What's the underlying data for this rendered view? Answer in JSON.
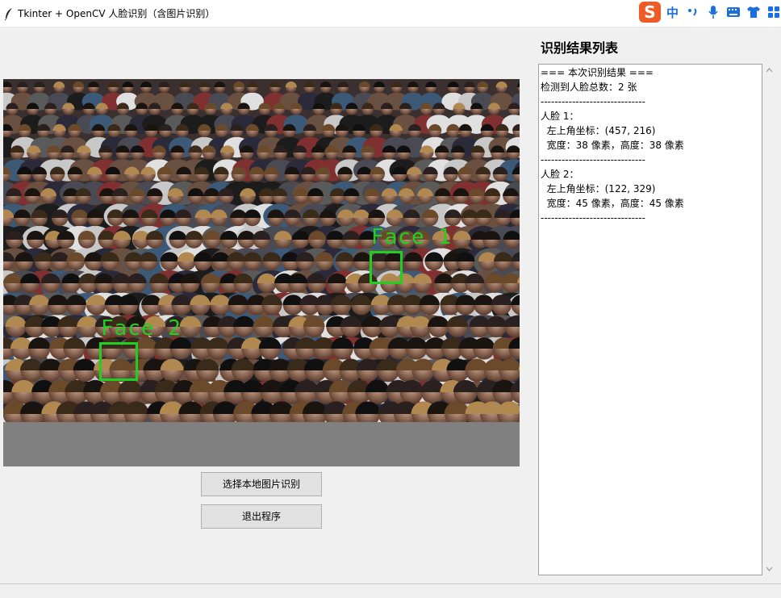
{
  "window": {
    "title": "Tkinter + OpenCV 人脸识别（含图片识别）",
    "icon": "feather-icon"
  },
  "ime_toolbar": {
    "logo": "S",
    "mode": "中",
    "icons": [
      "punctuation-icon",
      "microphone-icon",
      "keyboard-icon",
      "skin-icon",
      "apps-grid-icon"
    ]
  },
  "image_panel": {
    "faces": [
      {
        "label": "Face 1"
      },
      {
        "label": "Face 2"
      }
    ]
  },
  "buttons": {
    "select_label": "选择本地图片识别",
    "quit_label": "退出程序"
  },
  "results": {
    "title": "识别结果列表",
    "lines": [
      "=== 本次识别结果 ===",
      "检测到人脸总数：2 张",
      "------------------------------",
      "人脸 1：",
      "  左上角坐标：(457, 216)",
      "  宽度：38 像素，高度：38 像素",
      "------------------------------",
      "人脸 2：",
      "  左上角坐标：(122, 329)",
      "  宽度：45 像素，高度：45 像素",
      "------------------------------"
    ]
  },
  "colors": {
    "detection_box": "#20d020",
    "ime_logo": "#ef5b26",
    "ime_accent": "#1a6fde"
  }
}
